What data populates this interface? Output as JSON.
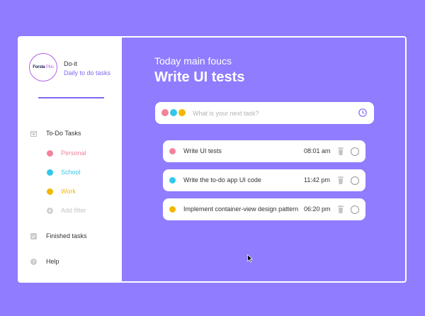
{
  "app": {
    "name": "Do-it",
    "subtitle": "Daily to do tasks",
    "logo": {
      "brand": "Forsta",
      "suffix": "Plus"
    }
  },
  "sidebar": {
    "todo_label": "To-Do Tasks",
    "filters": [
      {
        "label": "Personal",
        "color": "#f2839b"
      },
      {
        "label": "School",
        "color": "#33c7ea"
      },
      {
        "label": "Work",
        "color": "#f2b705"
      }
    ],
    "add_filter_label": "Add filter",
    "finished_label": "Finished tasks",
    "help_label": "Help"
  },
  "main": {
    "subtitle": "Today main foucs",
    "title": "Write UI tests",
    "input_placeholder": "What is your next task?",
    "tasks": [
      {
        "text": "Write UI tests",
        "time": "08:01 am",
        "color": "#f2839b"
      },
      {
        "text": "Write the to-do app UI code",
        "time": "11:42 pm",
        "color": "#33c7ea"
      },
      {
        "text": "Implement container-view design pattern",
        "time": "06:20 pm",
        "color": "#f2b705"
      }
    ]
  },
  "colors": {
    "background": "#8f7cff",
    "accent": "#7d6bf2",
    "logo_ring": "#b65ee6"
  }
}
